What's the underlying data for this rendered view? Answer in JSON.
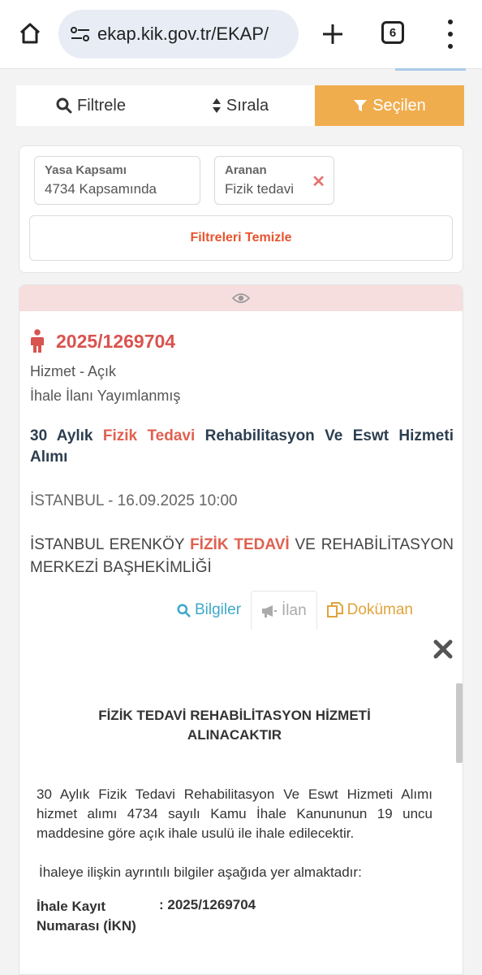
{
  "browser": {
    "url": "ekap.kik.gov.tr/EKAP/",
    "tab_count": "6",
    "icons": [
      "home-icon",
      "site-settings-icon",
      "plus-icon",
      "tabs-icon",
      "more-vert-icon"
    ]
  },
  "toolbar": {
    "filter_label": "Filtrele",
    "sort_label": "Sırala",
    "selected_label": "Seçilen"
  },
  "filters": {
    "chips": [
      {
        "label": "Yasa Kapsamı",
        "value": "4734 Kapsamında"
      },
      {
        "label": "Aranan",
        "value": "Fizik tedavi"
      }
    ],
    "clear_label": "Filtreleri Temizle"
  },
  "result": {
    "ikn": "2025/1269704",
    "type": "Hizmet - Açık",
    "status": "İhale İlanı Yayımlanmış",
    "title_pre": "30 Aylık ",
    "title_hl": "Fizik Tedavi",
    "title_post": " Rehabilitasyon Ve Eswt Hizmeti Alımı",
    "location_date": "İSTANBUL - 16.09.2025 10:00",
    "org_pre": "İSTANBUL ERENKÖY ",
    "org_hl": "FİZİK TEDAVİ",
    "org_post": " VE REHABİLİTASYON MERKEZİ BAŞHEKİMLİĞİ",
    "actions": {
      "info": "Bilgiler",
      "ilan": "İlan",
      "doc": "Doküman"
    }
  },
  "detail": {
    "heading": "FİZİK TEDAVİ REHABİLİTASYON HİZMETİ ALINACAKTIR",
    "paragraph": "30 Aylık Fizik Tedavi Rehabilitasyon Ve Eswt Hizmeti Alımı hizmet alımı 4734 sayılı Kamu İhale Kanununun 19 uncu maddesine göre açık ihale usulü ile ihale edilecektir.",
    "paragraph2": "İhaleye ilişkin ayrıntılı bilgiler aşağıda yer almaktadır:",
    "ikn_label": "İhale Kayıt Numarası (İKN)",
    "ikn_value": ": 2025/1269704"
  },
  "colors": {
    "accent_orange": "#f0ad4e",
    "ikn_red": "#d9534f",
    "info_blue": "#3fa9c9",
    "doc_gold": "#e0a43c",
    "header_pink": "#f6dede"
  }
}
